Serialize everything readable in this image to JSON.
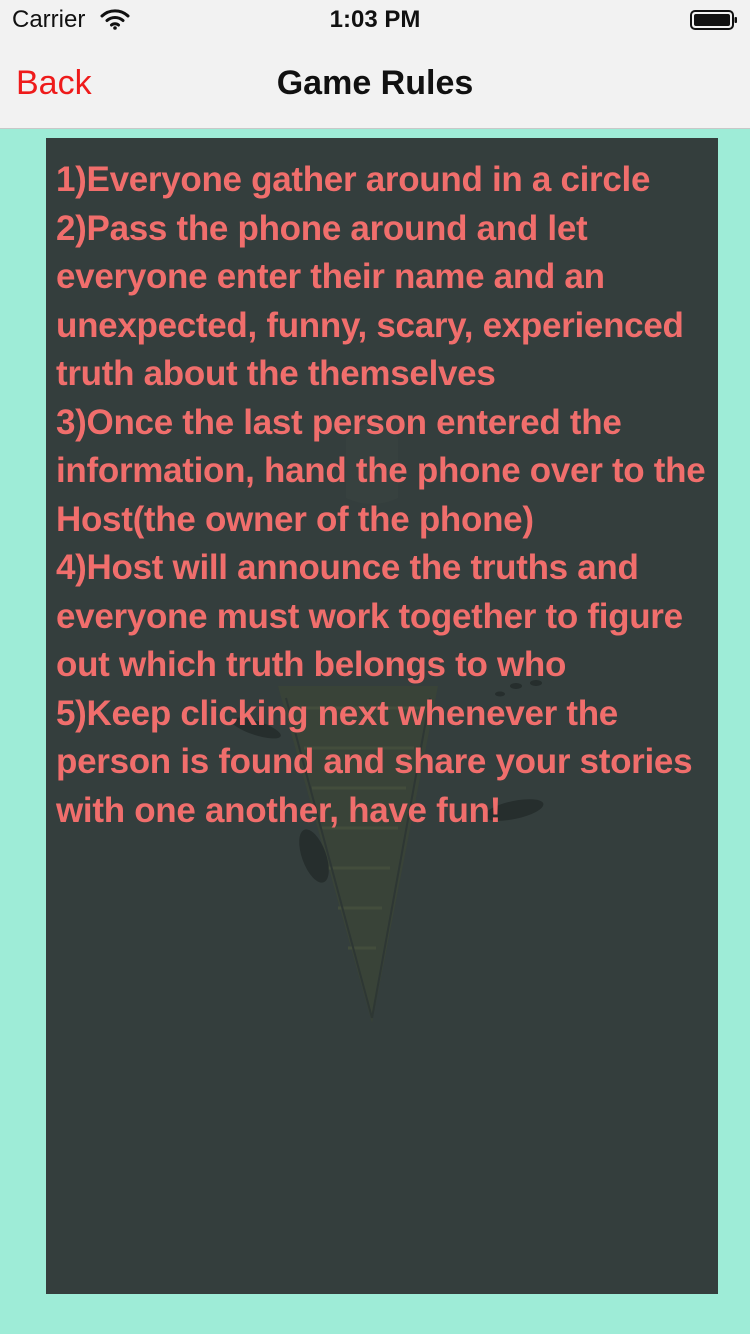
{
  "status_bar": {
    "carrier": "Carrier",
    "time": "1:03 PM",
    "wifi_icon": "wifi-icon",
    "battery_icon": "battery-full-icon"
  },
  "nav": {
    "back_label": "Back",
    "title": "Game Rules"
  },
  "rules": [
    "1)Everyone gather around in a circle",
    "2)Pass the phone around and let everyone enter their name and an unexpected, funny, scary, experienced truth about the themselves",
    "3)Once the last person entered the information, hand the phone over to the Host(the owner of the phone)",
    "4)Host will announce the truths and everyone must work together to figure out which truth belongs to who",
    "5)Keep clicking next whenever the person is found and share your stories with one another, have fun!"
  ],
  "colors": {
    "background": "#9eecd7",
    "panel": "#343e3d",
    "rule_text": "#f06e6c",
    "back_button": "#ee1b1b"
  }
}
